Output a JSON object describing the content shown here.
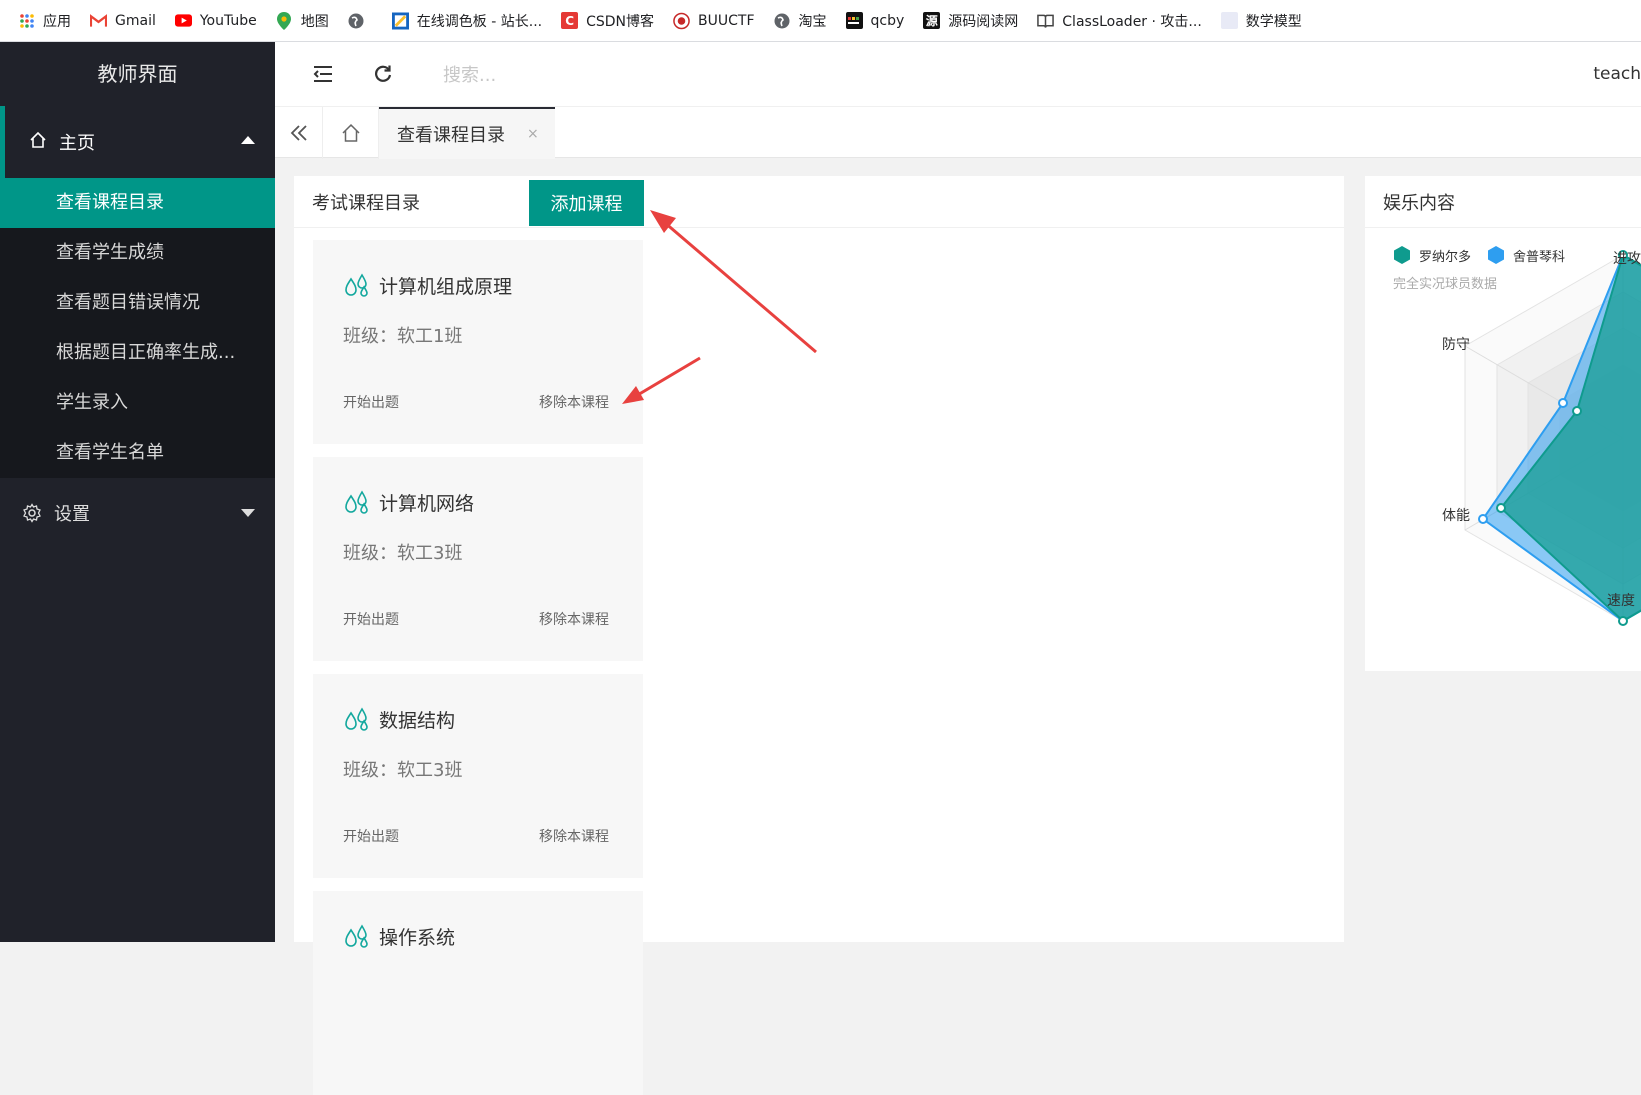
{
  "bookmarks": [
    {
      "label": "应用",
      "icon": "apps-grid-icon"
    },
    {
      "label": "Gmail",
      "icon": "gmail-icon"
    },
    {
      "label": "YouTube",
      "icon": "youtube-icon"
    },
    {
      "label": "地图",
      "icon": "maps-pin-icon"
    },
    {
      "label": "",
      "icon": "globe-icon"
    },
    {
      "label": "在线调色板 - 站长...",
      "icon": "palette-icon"
    },
    {
      "label": "CSDN博客",
      "icon": "csdn-icon"
    },
    {
      "label": "BUUCTF",
      "icon": "buuctf-icon"
    },
    {
      "label": "淘宝",
      "icon": "globe-icon"
    },
    {
      "label": "qcby",
      "icon": "qcby-icon"
    },
    {
      "label": "源码阅读网",
      "icon": "source-code-icon"
    },
    {
      "label": "ClassLoader · 攻击...",
      "icon": "book-icon"
    },
    {
      "label": "数学模型",
      "icon": "blank-page-icon"
    }
  ],
  "sidebar": {
    "title": "教师界面",
    "main_label": "主页",
    "items": [
      {
        "label": "查看课程目录",
        "active": true
      },
      {
        "label": "查看学生成绩",
        "active": false
      },
      {
        "label": "查看题目错误情况",
        "active": false
      },
      {
        "label": "根据题目正确率生成...",
        "active": false
      },
      {
        "label": "学生录入",
        "active": false
      },
      {
        "label": "查看学生名单",
        "active": false
      }
    ],
    "settings_label": "设置"
  },
  "header": {
    "search_placeholder": "搜索...",
    "user": "teach"
  },
  "tabs": {
    "active_label": "查看课程目录",
    "close_symbol": "×"
  },
  "courses_panel": {
    "title": "考试课程目录",
    "add_button": "添加课程",
    "start_label": "开始出题",
    "remove_label": "移除本课程",
    "cards": [
      {
        "name": "计算机组成原理",
        "class": "班级：软工1班"
      },
      {
        "name": "计算机网络",
        "class": "班级：软工3班"
      },
      {
        "name": "数据结构",
        "class": "班级：软工3班"
      },
      {
        "name": "操作系统",
        "class": ""
      }
    ]
  },
  "ent_panel": {
    "title": "娱乐内容",
    "subtitle": "完全实况球员数据",
    "legend": [
      {
        "name": "罗纳尔多",
        "color": "#0f9b8e"
      },
      {
        "name": "舍普琴科",
        "color": "#2e9ef0"
      }
    ],
    "axes": [
      "进攻",
      "防守",
      "体能",
      "速度"
    ]
  },
  "colors": {
    "accent": "#009688",
    "sidebar_bg": "#20222a",
    "annotation_arrow": "#e8413f"
  }
}
